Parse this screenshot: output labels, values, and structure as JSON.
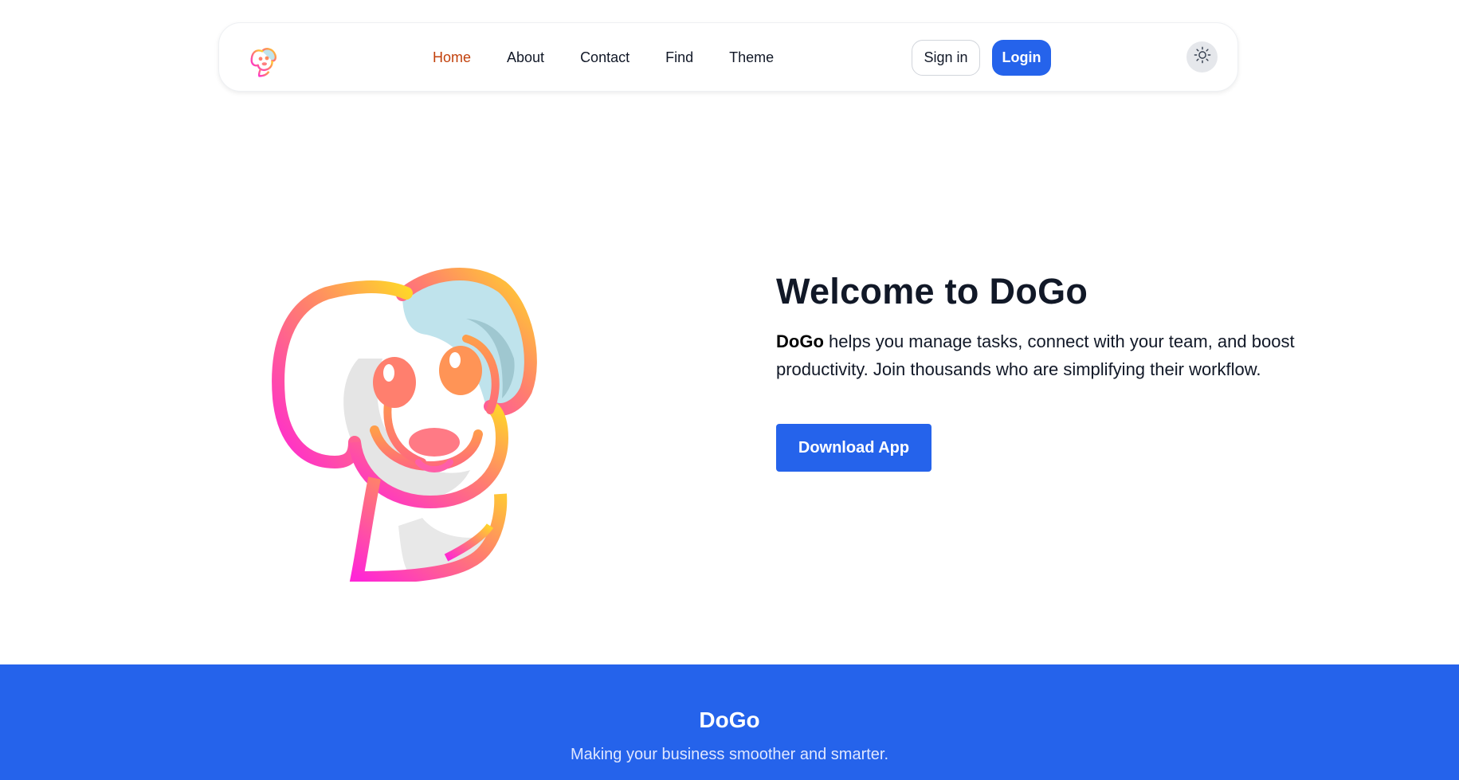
{
  "nav": {
    "logo_icon": "dog-logo-icon",
    "links": [
      {
        "label": "Home",
        "active": true
      },
      {
        "label": "About",
        "active": false
      },
      {
        "label": "Contact",
        "active": false
      },
      {
        "label": "Find",
        "active": false
      },
      {
        "label": "Theme",
        "active": false
      }
    ],
    "signin_label": "Sign in",
    "login_label": "Login",
    "theme_icon": "sun-icon"
  },
  "hero": {
    "title": "Welcome to DoGo",
    "brand": "DoGo",
    "description": " helps you manage tasks, connect with your team, and boost productivity. Join thousands who are simplifying their workflow.",
    "download_label": "Download App",
    "illustration_icon": "dog-illustration-icon"
  },
  "footer": {
    "title": "DoGo",
    "tagline": "Making your business smoother and smarter."
  },
  "colors": {
    "accent": "#2563eb",
    "active_link": "#c2410c",
    "text": "#111827"
  }
}
